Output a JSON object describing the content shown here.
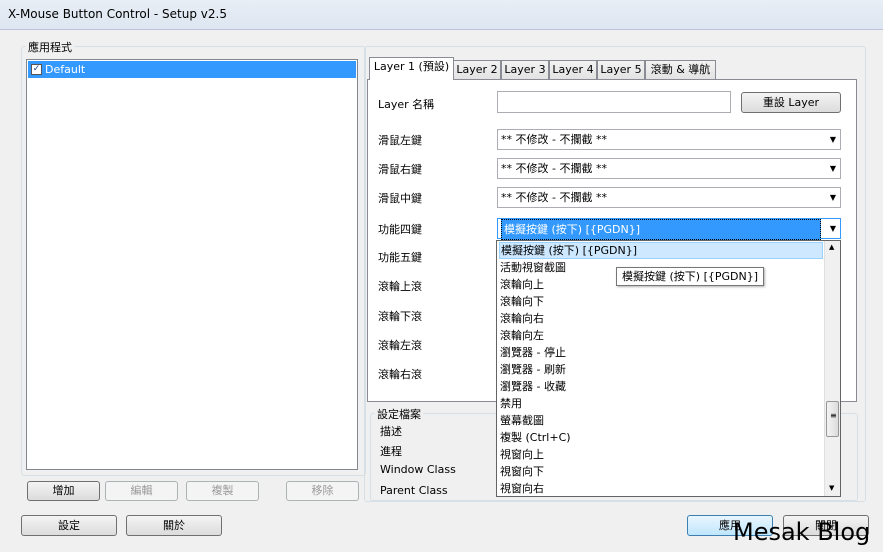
{
  "window": {
    "title": "X-Mouse Button Control - Setup v2.5"
  },
  "apps": {
    "group_label": "應用程式",
    "items": [
      {
        "label": "Default",
        "checked": true
      }
    ],
    "buttons": {
      "add": "增加",
      "edit": "編輯",
      "copy": "複製",
      "remove": "移除"
    }
  },
  "tabs": [
    "Layer 1 (預設)",
    "Layer 2",
    "Layer 3",
    "Layer 4",
    "Layer 5",
    "滾動 & 導航"
  ],
  "layer": {
    "name_label": "Layer 名稱",
    "name_value": "",
    "reset_label": "重設 Layer",
    "rows": [
      {
        "label": "滑鼠左鍵",
        "value": "** 不修改 - 不攔截 **"
      },
      {
        "label": "滑鼠右鍵",
        "value": "** 不修改 - 不攔截 **"
      },
      {
        "label": "滑鼠中鍵",
        "value": "** 不修改 - 不攔截 **"
      },
      {
        "label": "功能四鍵",
        "value": "模擬按鍵 (按下) [{PGDN}]"
      },
      {
        "label": "功能五鍵",
        "value": ""
      },
      {
        "label": "滾輪上滾",
        "value": ""
      },
      {
        "label": "滾輪下滾",
        "value": ""
      },
      {
        "label": "滾輪左滾",
        "value": ""
      },
      {
        "label": "滾輪右滾",
        "value": ""
      }
    ]
  },
  "dropdown": {
    "items": [
      "模擬按鍵 (按下) [{PGDN}]",
      "活動視窗截圖",
      "滾輪向上",
      "滾輪向下",
      "滾輪向右",
      "滾輪向左",
      "瀏覽器 - 停止",
      "瀏覽器 - 刷新",
      "瀏覽器 - 收藏",
      "禁用",
      "螢幕截圖",
      "複製 (Ctrl+C)",
      "視窗向上",
      "視窗向下",
      "視窗向右"
    ],
    "highlighted_index": 0
  },
  "tooltip": "模擬按鍵 (按下) [{PGDN}]",
  "profile": {
    "group_label": "設定檔案",
    "fields": [
      "描述",
      "進程",
      "Window Class",
      "Parent Class"
    ]
  },
  "footer": {
    "settings": "設定",
    "close": "關於",
    "apply": "應用",
    "close2": "關閉"
  },
  "watermark": "Mesak Blog",
  "colors": {
    "selection": "#3399ff",
    "highlight": "#cde8ff",
    "titlebar": "#dde6f1"
  }
}
